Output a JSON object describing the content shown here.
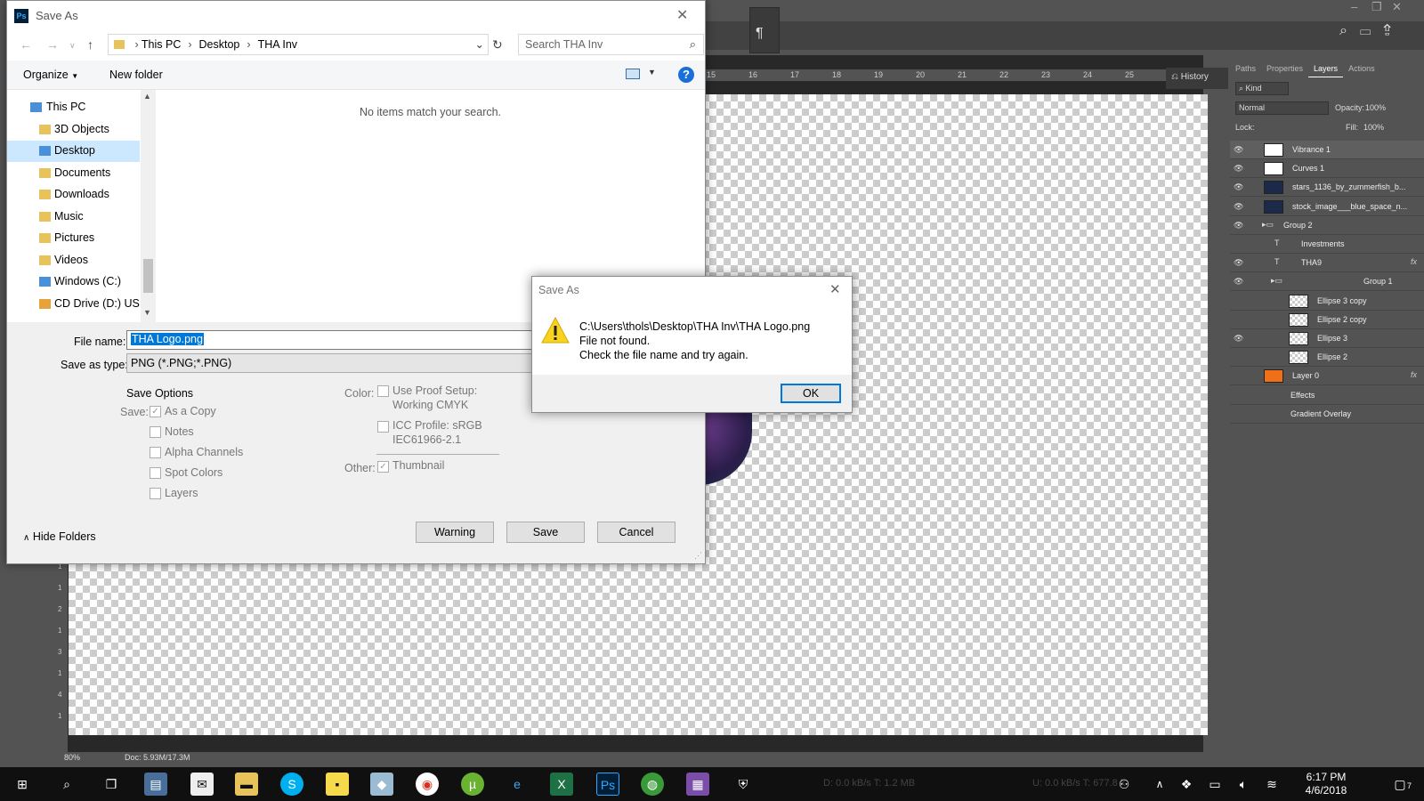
{
  "photoshop": {
    "ruler_top": [
      "15",
      "16",
      "17",
      "18",
      "19",
      "20",
      "21",
      "22",
      "23",
      "24",
      "25"
    ],
    "ruler_left": [
      "1",
      "1",
      "2",
      "1",
      "3",
      "1",
      "4",
      "1"
    ],
    "history_label": "History",
    "status_zoom": "80%",
    "status_doc": "Doc: 5.93M/17.3M",
    "panel_tabs": [
      "Paths",
      "Properties",
      "Layers",
      "Actions"
    ],
    "active_tab": "Layers",
    "kind_label": "Kind",
    "blend_mode": "Normal",
    "opacity_label": "Opacity:",
    "opacity_value": "100%",
    "lock_label": "Lock:",
    "fill_label": "Fill:",
    "fill_value": "100%",
    "layers": [
      {
        "name": "Vibrance 1",
        "visible": true,
        "thumb": "white"
      },
      {
        "name": "Curves 1",
        "visible": true,
        "thumb": "white"
      },
      {
        "name": "stars_1136_by_zummerfish_b...",
        "visible": true,
        "thumb": "dark"
      },
      {
        "name": "stock_image___blue_space_n...",
        "visible": true,
        "thumb": "dark"
      },
      {
        "name": "Group 2",
        "visible": true,
        "thumb": "folder"
      },
      {
        "name": "Investments",
        "visible": false,
        "thumb": "text"
      },
      {
        "name": "THA9",
        "visible": true,
        "thumb": "text"
      },
      {
        "name": "Group 1",
        "visible": true,
        "thumb": "folder"
      },
      {
        "name": "Ellipse 3 copy",
        "visible": false,
        "thumb": "checker"
      },
      {
        "name": "Ellipse 2 copy",
        "visible": false,
        "thumb": "checker"
      },
      {
        "name": "Ellipse 3",
        "visible": true,
        "thumb": "checker"
      },
      {
        "name": "Ellipse 2",
        "visible": false,
        "thumb": "checker"
      },
      {
        "name": "Layer 0",
        "visible": false,
        "thumb": "orange"
      },
      {
        "name": "Effects",
        "visible": false,
        "thumb": "none"
      },
      {
        "name": "Gradient Overlay",
        "visible": false,
        "thumb": "none"
      }
    ],
    "fx_label": "fx"
  },
  "save_dialog": {
    "title": "Save As",
    "breadcrumb": [
      "This PC",
      "Desktop",
      "THA Inv"
    ],
    "search_placeholder": "Search THA Inv",
    "organize_label": "Organize",
    "new_folder_label": "New folder",
    "nav_items": [
      "This PC",
      "3D Objects",
      "Desktop",
      "Documents",
      "Downloads",
      "Music",
      "Pictures",
      "Videos",
      "Windows (C:)",
      "CD Drive (D:) US"
    ],
    "selected_nav": "Desktop",
    "empty_message": "No items match your search.",
    "file_name_label": "File name:",
    "file_name_value": "THA Logo.png",
    "save_type_label": "Save as type:",
    "save_type_value": "PNG (*.PNG;*.PNG)",
    "save_options_title": "Save Options",
    "save_label": "Save:",
    "save_checks": [
      {
        "label": "As a Copy",
        "checked": true
      },
      {
        "label": "Notes",
        "checked": false
      },
      {
        "label": "Alpha Channels",
        "checked": false
      },
      {
        "label": "Spot Colors",
        "checked": false
      },
      {
        "label": "Layers",
        "checked": false
      }
    ],
    "color_label": "Color:",
    "proof_label": "Use Proof Setup:",
    "proof_value": "Working CMYK",
    "icc_label": "ICC Profile:  sRGB",
    "icc_value": "IEC61966-2.1",
    "other_label": "Other:",
    "thumbnail_label": "Thumbnail",
    "hide_folders_label": "Hide Folders",
    "warning_button": "Warning",
    "save_button": "Save",
    "cancel_button": "Cancel"
  },
  "error_dialog": {
    "title": "Save As",
    "line1": "C:\\Users\\thols\\Desktop\\THA Inv\\THA Logo.png",
    "line2": "File not found.",
    "line3": "Check the file name and try again.",
    "ok_button": "OK"
  },
  "taskbar": {
    "time": "6:17 PM",
    "date": "4/6/2018",
    "net_down": "D: 0.0 kB/s T: 1.2 MB",
    "net_up": "U: 0.0 kB/s T: 677.8 k",
    "notification_count": "7"
  }
}
